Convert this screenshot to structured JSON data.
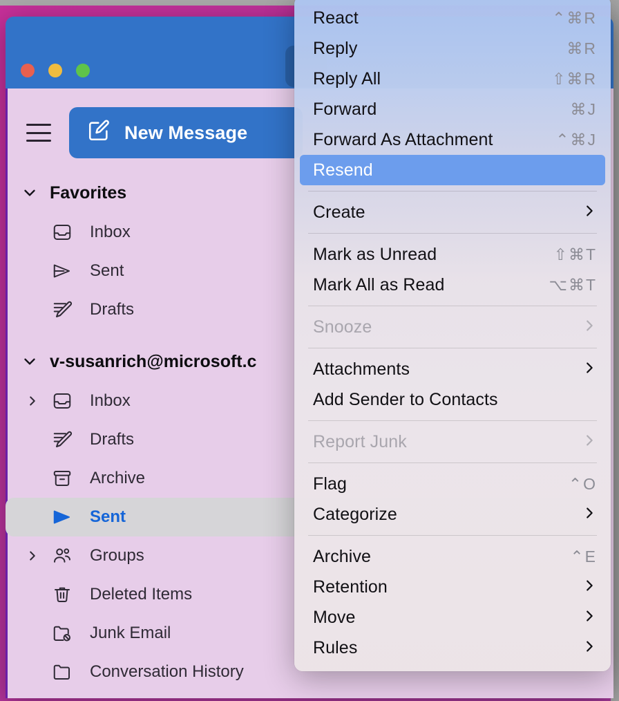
{
  "window": {
    "traffic_lights": [
      "close",
      "minimize",
      "zoom"
    ],
    "accent_blue": "#3273c8",
    "sidebar_bg": "#e7cde9",
    "wallpaper": "#b9339c"
  },
  "sidebar": {
    "hamburger_label": "sidebar-toggle",
    "new_message_label": "New Message",
    "favorites": {
      "title": "Favorites",
      "items": [
        {
          "label": "Inbox",
          "icon": "inbox-icon"
        },
        {
          "label": "Sent",
          "icon": "paper-plane-icon"
        },
        {
          "label": "Drafts",
          "icon": "pencil-lines-icon"
        }
      ]
    },
    "account": {
      "title": "v-susanrich@microsoft.c",
      "items": [
        {
          "label": "Inbox",
          "icon": "inbox-icon",
          "disclosure": true,
          "selected": false
        },
        {
          "label": "Drafts",
          "icon": "pencil-lines-icon",
          "disclosure": false,
          "selected": false
        },
        {
          "label": "Archive",
          "icon": "archive-box-icon",
          "disclosure": false,
          "selected": false
        },
        {
          "label": "Sent",
          "icon": "paper-plane-icon",
          "disclosure": false,
          "selected": true
        },
        {
          "label": "Groups",
          "icon": "people-icon",
          "disclosure": true,
          "selected": false
        },
        {
          "label": "Deleted Items",
          "icon": "trash-icon",
          "disclosure": false,
          "selected": false
        },
        {
          "label": "Junk Email",
          "icon": "folder-block-icon",
          "disclosure": false,
          "selected": false
        },
        {
          "label": "Conversation History",
          "icon": "folder-icon",
          "disclosure": false,
          "selected": false
        }
      ]
    }
  },
  "context_menu": {
    "highlight_color": "#6c9ded",
    "items": [
      {
        "type": "item",
        "label": "React",
        "shortcut": "⌃⌘R",
        "submenu": false,
        "disabled": false,
        "highlighted": false
      },
      {
        "type": "item",
        "label": "Reply",
        "shortcut": "⌘R",
        "submenu": false,
        "disabled": false,
        "highlighted": false
      },
      {
        "type": "item",
        "label": "Reply All",
        "shortcut": "⇧⌘R",
        "submenu": false,
        "disabled": false,
        "highlighted": false
      },
      {
        "type": "item",
        "label": "Forward",
        "shortcut": "⌘J",
        "submenu": false,
        "disabled": false,
        "highlighted": false
      },
      {
        "type": "item",
        "label": "Forward As Attachment",
        "shortcut": "⌃⌘J",
        "submenu": false,
        "disabled": false,
        "highlighted": false
      },
      {
        "type": "item",
        "label": "Resend",
        "shortcut": "",
        "submenu": false,
        "disabled": false,
        "highlighted": true
      },
      {
        "type": "sep"
      },
      {
        "type": "item",
        "label": "Create",
        "shortcut": "",
        "submenu": true,
        "disabled": false,
        "highlighted": false
      },
      {
        "type": "sep"
      },
      {
        "type": "item",
        "label": "Mark as Unread",
        "shortcut": "⇧⌘T",
        "submenu": false,
        "disabled": false,
        "highlighted": false
      },
      {
        "type": "item",
        "label": "Mark All as Read",
        "shortcut": "⌥⌘T",
        "submenu": false,
        "disabled": false,
        "highlighted": false
      },
      {
        "type": "sep"
      },
      {
        "type": "item",
        "label": "Snooze",
        "shortcut": "",
        "submenu": true,
        "disabled": true,
        "highlighted": false
      },
      {
        "type": "sep"
      },
      {
        "type": "item",
        "label": "Attachments",
        "shortcut": "",
        "submenu": true,
        "disabled": false,
        "highlighted": false
      },
      {
        "type": "item",
        "label": "Add Sender to Contacts",
        "shortcut": "",
        "submenu": false,
        "disabled": false,
        "highlighted": false
      },
      {
        "type": "sep"
      },
      {
        "type": "item",
        "label": "Report Junk",
        "shortcut": "",
        "submenu": true,
        "disabled": true,
        "highlighted": false
      },
      {
        "type": "sep"
      },
      {
        "type": "item",
        "label": "Flag",
        "shortcut": "⌃O",
        "submenu": false,
        "disabled": false,
        "highlighted": false
      },
      {
        "type": "item",
        "label": "Categorize",
        "shortcut": "",
        "submenu": true,
        "disabled": false,
        "highlighted": false
      },
      {
        "type": "sep"
      },
      {
        "type": "item",
        "label": "Archive",
        "shortcut": "⌃E",
        "submenu": false,
        "disabled": false,
        "highlighted": false
      },
      {
        "type": "item",
        "label": "Retention",
        "shortcut": "",
        "submenu": true,
        "disabled": false,
        "highlighted": false
      },
      {
        "type": "item",
        "label": "Move",
        "shortcut": "",
        "submenu": true,
        "disabled": false,
        "highlighted": false
      },
      {
        "type": "item",
        "label": "Rules",
        "shortcut": "",
        "submenu": true,
        "disabled": false,
        "highlighted": false
      }
    ]
  }
}
